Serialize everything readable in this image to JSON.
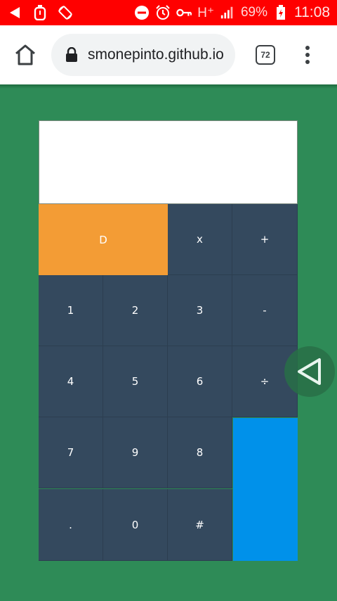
{
  "status_bar": {
    "icons": [
      "back-arrow-icon",
      "stopwatch-icon",
      "rotate-icon",
      "do-not-disturb-icon",
      "alarm-icon",
      "vpn-key-icon",
      "signal-icon",
      "battery-icon"
    ],
    "network": "H⁺",
    "battery": "69%",
    "time": "11:08",
    "background": "#ff0000"
  },
  "browser": {
    "url": "smonepinto.github.io",
    "tab_count": "72"
  },
  "calculator": {
    "display_value": "",
    "keys": {
      "del": "D",
      "multiply": "x",
      "add": "+",
      "one": "1",
      "two": "2",
      "three": "3",
      "subtract": "-",
      "four": "4",
      "five": "5",
      "six": "6",
      "divide": "÷",
      "seven": "7",
      "nine": "9",
      "eight": "8",
      "decimal": ".",
      "zero": "0",
      "hash": "#",
      "equals": ""
    },
    "colors": {
      "key": "#34495e",
      "delete": "#f39c35",
      "equals": "#0091ea",
      "page_background": "#2e8b57"
    }
  }
}
